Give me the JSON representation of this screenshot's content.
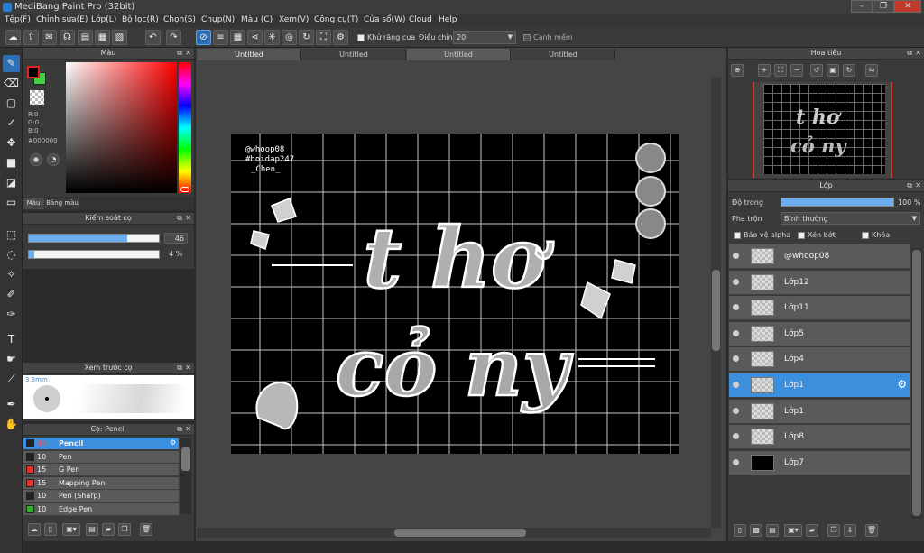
{
  "window": {
    "title": "MediBang Paint Pro (32bit)",
    "min": "–",
    "max": "❐",
    "close": "✕"
  },
  "menu": [
    "Tệp(F)",
    "Chỉnh sửa(E)",
    "Lớp(L)",
    "Bộ lọc(R)",
    "Chọn(S)",
    "Chụp(N)",
    "Màu (C)",
    "Xem(V)",
    "Công cụ(T)",
    "Cửa sổ(W)",
    "Cloud",
    "Help"
  ],
  "toolbar": {
    "antialias_label": "Khử răng cưa",
    "correction_label": "Điều chỉnh",
    "correction_value": "20",
    "sharp_label": "Cạnh mềm"
  },
  "color_panel": {
    "title": "Màu",
    "r": "R:0",
    "g": "G:0",
    "b": "B:0",
    "hex": "#000000",
    "tab_color": "Màu",
    "tab_palette": "Bảng màu"
  },
  "brush_control": {
    "title": "Kiểm soát cọ",
    "size_value": "46",
    "opacity_value": "4 %",
    "size_fraction": 0.76,
    "opacity_fraction": 0.04
  },
  "brush_preview": {
    "title": "Xem trước cọ",
    "size_label": "3.3mm"
  },
  "brush_list": {
    "title": "Cọ: Pencil",
    "items": [
      {
        "size": "46",
        "name": "Pencil",
        "color": "#222222",
        "selected": true
      },
      {
        "size": "10",
        "name": "Pen",
        "color": "#222222",
        "selected": false
      },
      {
        "size": "15",
        "name": "G Pen",
        "color": "#e03030",
        "selected": false
      },
      {
        "size": "15",
        "name": "Mapping Pen",
        "color": "#e03030",
        "selected": false
      },
      {
        "size": "10",
        "name": "Pen (Sharp)",
        "color": "#222222",
        "selected": false
      },
      {
        "size": "10",
        "name": "Edge Pen",
        "color": "#30b030",
        "selected": false
      }
    ]
  },
  "tabs": [
    "Untitled",
    "Untitled",
    "Untitled",
    "Untitled"
  ],
  "canvas": {
    "watermark_line1": "@whoop08",
    "watermark_line2": "#hoidap247",
    "watermark_line3": "_Chen_",
    "headline_line1": "t hơ",
    "headline_line2": "cỏ ny"
  },
  "navigator": {
    "title": "Hoa tiêu"
  },
  "layers": {
    "title": "Lớp",
    "opacity_label": "Độ trong",
    "opacity_value": "100 %",
    "opacity_fraction": 1.0,
    "blend_label": "Pha trộn",
    "blend_value": "Bình thường",
    "protect_alpha": "Bảo vệ alpha",
    "clipping": "Xén bớt",
    "lock": "Khóa",
    "items": [
      {
        "name": "@whoop08",
        "selected": false,
        "dark": false
      },
      {
        "name": "Lớp12",
        "selected": false,
        "dark": false
      },
      {
        "name": "Lớp11",
        "selected": false,
        "dark": false
      },
      {
        "name": "Lớp5",
        "selected": false,
        "dark": false
      },
      {
        "name": "Lớp4",
        "selected": false,
        "dark": false
      },
      {
        "name": "Lớp1",
        "selected": true,
        "dark": false
      },
      {
        "name": "Lớp1",
        "selected": false,
        "dark": false
      },
      {
        "name": "Lớp8",
        "selected": false,
        "dark": false
      },
      {
        "name": "Lớp7",
        "selected": false,
        "dark": true
      }
    ]
  },
  "colors": {
    "accent": "#3b8fdc",
    "canvas_bg": "#000000",
    "foreground": "#000000",
    "background": "#ffffff"
  }
}
